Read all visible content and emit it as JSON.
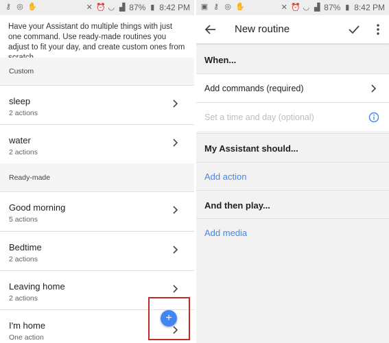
{
  "status_bar": {
    "battery": "87%",
    "time": "8:42 PM"
  },
  "left": {
    "intro": "Have your Assistant do multiple things with just one command. Use ready-made routines you adjust to fit your day, and create custom ones from scratch.",
    "custom_header": "Custom",
    "custom_items": [
      {
        "title": "sleep",
        "subtitle": "2 actions"
      },
      {
        "title": "water",
        "subtitle": "2 actions"
      }
    ],
    "readymade_header": "Ready-made",
    "readymade_items": [
      {
        "title": "Good morning",
        "subtitle": "5 actions"
      },
      {
        "title": "Bedtime",
        "subtitle": "2 actions"
      },
      {
        "title": "Leaving home",
        "subtitle": "2 actions"
      },
      {
        "title": "I'm home",
        "subtitle": "One action"
      }
    ],
    "fab": {
      "icon": "plus-icon",
      "label": "+",
      "highlight_color": "#c62828",
      "color": "#4285f4"
    }
  },
  "right": {
    "title": "New routine",
    "when_header": "When...",
    "add_commands": "Add commands (required)",
    "set_time": "Set a time and day (optional)",
    "assistant_header": "My Assistant should...",
    "add_action": "Add action",
    "then_play_header": "And then play...",
    "add_media": "Add media",
    "accent_color": "#4285f4"
  }
}
